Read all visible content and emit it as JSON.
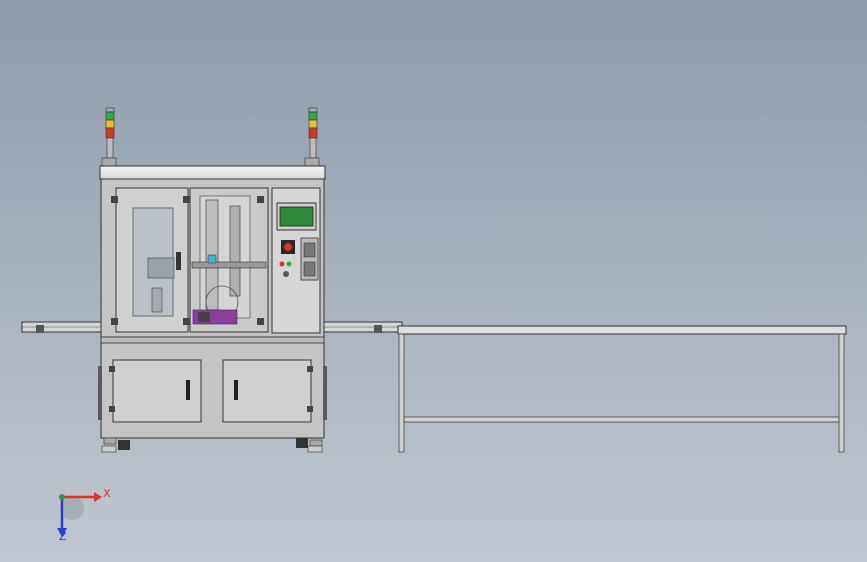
{
  "viewport": {
    "background": [
      "#8e9bab",
      "#bfc6cf"
    ]
  },
  "triad": {
    "x_label": "X",
    "z_label": "Z",
    "colors": {
      "x": "#e03030",
      "y": "#2f9a3c",
      "z": "#2e3fd0"
    }
  },
  "machine": {
    "colors": {
      "frame": "#c4c4c4",
      "door": "#cfd0d0",
      "hmi_screen": "#2e8a3a",
      "accent_purple": "#8a3fa0",
      "accent_cyan": "#3fb6c8"
    },
    "tower_light_colors": [
      "#2fa84a",
      "#e2c033",
      "#d03a2e"
    ]
  },
  "hmi": {
    "power_icon": "power-icon"
  }
}
